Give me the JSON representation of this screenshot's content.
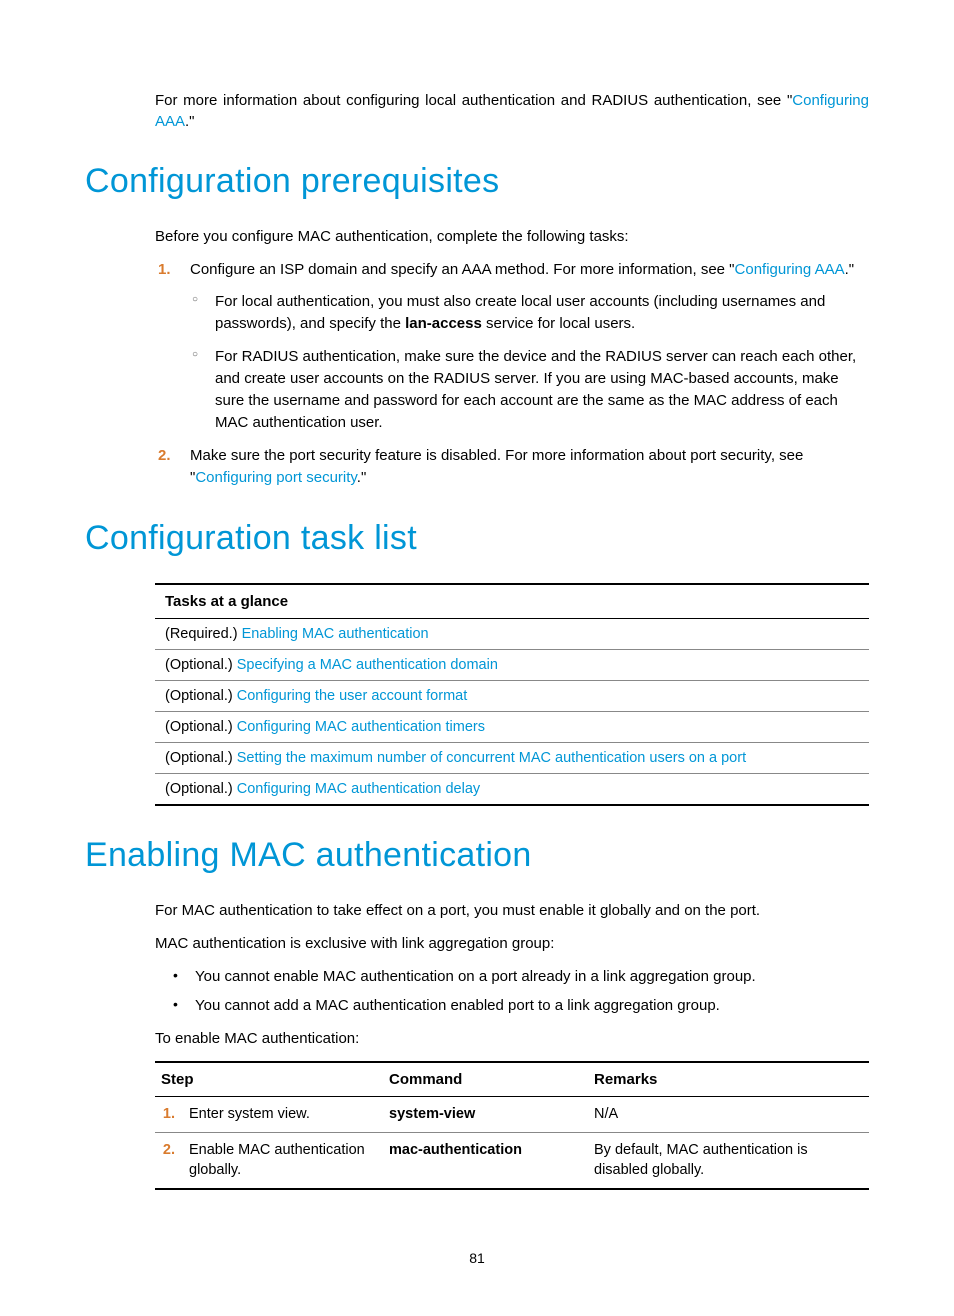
{
  "intro": {
    "text_before": "For more information about configuring local authentication and RADIUS authentication, see \"",
    "link": "Configuring AAA",
    "text_after": ".\""
  },
  "section1": {
    "heading": "Configuration prerequisites",
    "intro": "Before you configure MAC authentication, complete the following tasks:",
    "item1": {
      "num": "1.",
      "before": "Configure an ISP domain and specify an AAA method. For more information, see \"",
      "link": "Configuring AAA",
      "after": ".\"",
      "sub_a_before": "For local authentication, you must also create local user accounts (including usernames and passwords), and specify the ",
      "sub_a_bold": "lan-access",
      "sub_a_after": " service for local users.",
      "sub_b": "For RADIUS authentication, make sure the device and the RADIUS server can reach each other, and create user accounts on the RADIUS server. If you are using MAC-based accounts, make sure the username and password for each account are the same as the MAC address of each MAC authentication user."
    },
    "item2": {
      "num": "2.",
      "before": "Make sure the port security feature is disabled. For more information about port security, see \"",
      "link": "Configuring port security",
      "after": ".\""
    }
  },
  "section2": {
    "heading": "Configuration task list",
    "table_header": "Tasks at a glance",
    "rows": [
      {
        "prefix": "(Required.) ",
        "link": "Enabling MAC authentication"
      },
      {
        "prefix": "(Optional.) ",
        "link": "Specifying a MAC authentication domain"
      },
      {
        "prefix": "(Optional.) ",
        "link": "Configuring the user account format"
      },
      {
        "prefix": "(Optional.) ",
        "link": "Configuring MAC authentication timers"
      },
      {
        "prefix": "(Optional.) ",
        "link": "Setting the maximum number of concurrent MAC authentication users on a port"
      },
      {
        "prefix": "(Optional.) ",
        "link": "Configuring MAC authentication delay"
      }
    ]
  },
  "section3": {
    "heading": "Enabling MAC authentication",
    "p1": "For MAC authentication to take effect on a port, you must enable it globally and on the port.",
    "p2": "MAC authentication is exclusive with link aggregation group:",
    "bullets": [
      "You cannot enable MAC authentication on a port already in a link aggregation group.",
      "You cannot add a MAC authentication enabled port to a link aggregation group."
    ],
    "p3": "To enable MAC authentication:",
    "table": {
      "h1": "Step",
      "h2": "Command",
      "h3": "Remarks",
      "rows": [
        {
          "num": "1.",
          "step": "Enter system view.",
          "cmd": "system-view",
          "remarks": "N/A"
        },
        {
          "num": "2.",
          "step": "Enable MAC authentication globally.",
          "cmd": "mac-authentication",
          "remarks": "By default, MAC authentication is disabled globally."
        }
      ]
    }
  },
  "page_number": "81"
}
